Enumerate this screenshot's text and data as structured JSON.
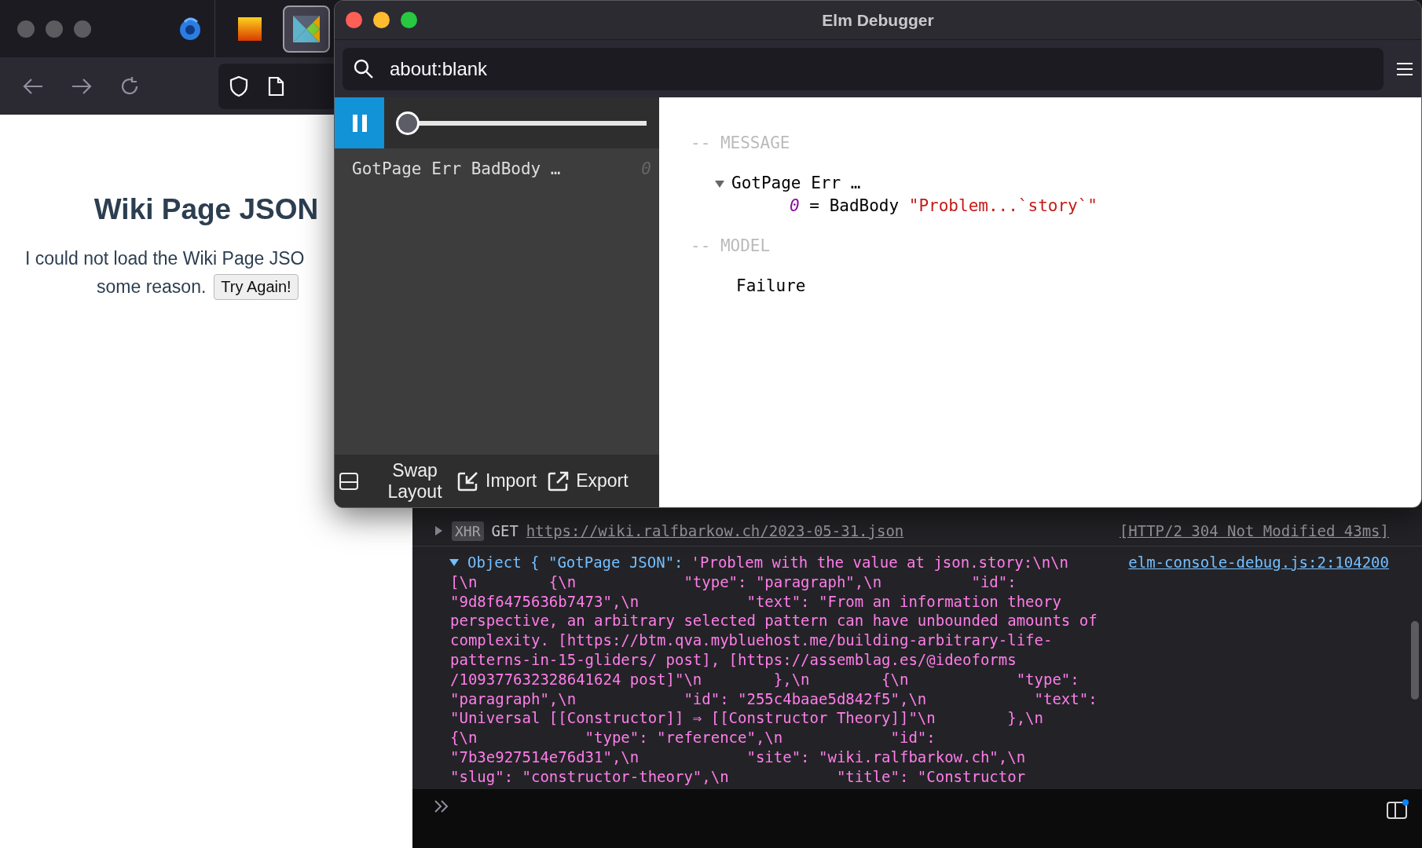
{
  "browser": {
    "pinned_tabs": [
      {
        "selected": false
      },
      {
        "selected": true
      }
    ]
  },
  "page": {
    "title": "Wiki Page JSON",
    "message_line_1": "I could not load the Wiki Page JSO",
    "message_line_2": "some reason.",
    "button": "Try Again!"
  },
  "debugger": {
    "title": "Elm Debugger",
    "address": "about:blank",
    "slider": {
      "level": 0
    },
    "messages": [
      {
        "text": "GotPage Err BadBody …",
        "index": "0",
        "selected": false
      }
    ],
    "footer_buttons": [
      {
        "kind": "swap",
        "label": "Swap Layout"
      },
      {
        "kind": "import",
        "label": "Import"
      },
      {
        "kind": "export",
        "label": "Export"
      }
    ],
    "message_heading": "-- MESSAGE",
    "message_tree": {
      "label": "GotPage Err …",
      "expanded": true,
      "children": [
        {
          "key": "0",
          "separator": "=",
          "value": "BadBody",
          "string": "\"Problem...`story`\""
        }
      ]
    },
    "model_heading": "-- MODEL",
    "model_value": "Failure"
  },
  "console": {
    "network": {
      "expanded": false,
      "badge": "XHR",
      "method": "GET",
      "url": "https://wiki.ralfbarkow.ch/2023-05-31.json",
      "status": "[HTTP/2 304 Not Modified 43ms]"
    },
    "log": {
      "expanded": true,
      "prefix": "Object {",
      "key": "\"GotPage JSON\":",
      "source": "elm-console-debug.js:2:104200",
      "lines": [
        "'Problem with the value at json.story:\\n\\n",
        "[\\n        {\\n            \"type\": \"paragraph\",\\n          \"id\":",
        "\"9d8f6475636b7473\",\\n            \"text\": \"From an information theory",
        "perspective, an arbitrary selected pattern can have unbounded amounts of",
        "complexity. [https://btm.qva.mybluehost.me/building-arbitrary-life-",
        "patterns-in-15-gliders/ post], [https://assemblag.es/@ideoforms",
        "/109377632328641624 post]\"\\n        },\\n        {\\n            \"type\":",
        "\"paragraph\",\\n            \"id\": \"255c4baae5d842f5\",\\n            \"text\":",
        "\"Universal [[Constructor]] ⇒ [[Constructor Theory]]\"\\n        },\\n",
        "{\\n            \"type\": \"reference\",\\n            \"id\":",
        "\"7b3e927514e76d31\",\\n            \"site\": \"wiki.ralfbarkow.ch\",\\n",
        "\"slug\": \"constructor-theory\",\\n            \"title\": \"Constructor"
      ]
    }
  }
}
